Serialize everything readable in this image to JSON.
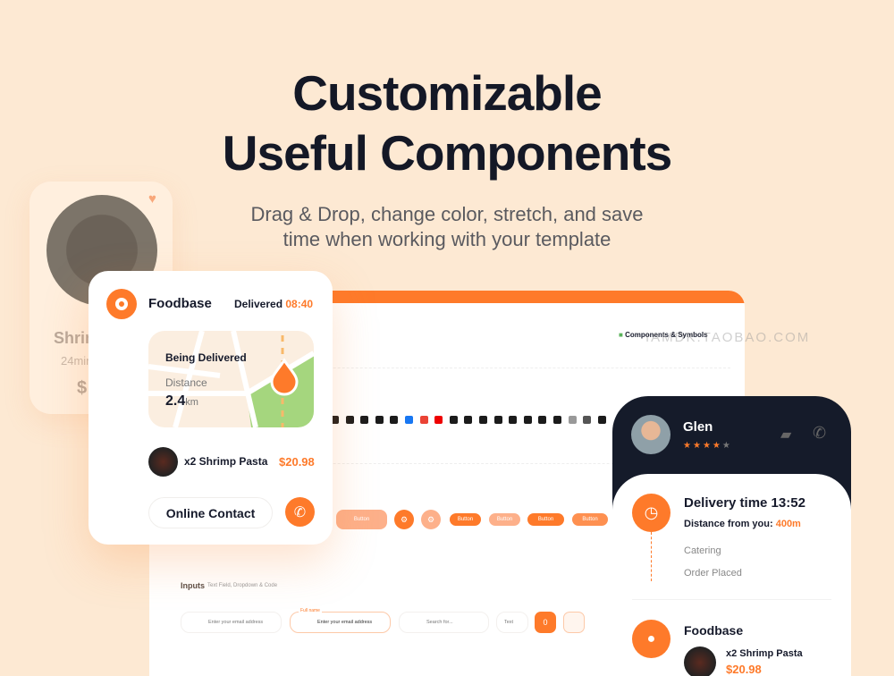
{
  "hero": {
    "title_line1": "Customizable",
    "title_line2": "Useful Components",
    "subtitle_line1": "Drag & Drop, change color, stretch, and save",
    "subtitle_line2": "time when working with your template"
  },
  "watermark": "IAMDK.TAOBAO.COM",
  "food_card": {
    "name": "Shrimp Pasta",
    "time": "24min",
    "price": "$"
  },
  "panel": {
    "section_title": "Components & Symbols",
    "button_label": "Button",
    "inputs_title": "Inputs",
    "inputs_subtitle": "Text Field, Dropdown & Code",
    "email_placeholder": "Enter your email address",
    "fullname_label": "Full name",
    "search_placeholder": "Search for...",
    "dropdown_value": "Text",
    "code_value": "0"
  },
  "delivery_card": {
    "brand": "Foodbase",
    "delivered_label": "Delivered",
    "delivered_time": "08:40",
    "status": "Being Delivered",
    "distance_label": "Distance",
    "distance_value": "2.4",
    "distance_unit": "km",
    "item": "x2 Shrimp Pasta",
    "price": "$20.98",
    "contact_button": "Online Contact"
  },
  "courier_card": {
    "name": "Glen",
    "rating": 4,
    "max_rating": 5,
    "delivery_time": "Delivery time 13:52",
    "distance_label": "Distance from you:",
    "distance_value": "400m",
    "step1": "Catering",
    "step2": "Order Placed",
    "brand": "Foodbase",
    "item": "x2 Shrimp Pasta",
    "price": "$20.98"
  },
  "colors": {
    "accent": "#fe7a2a",
    "dark": "#151b2a",
    "background": "#fde9d3"
  }
}
